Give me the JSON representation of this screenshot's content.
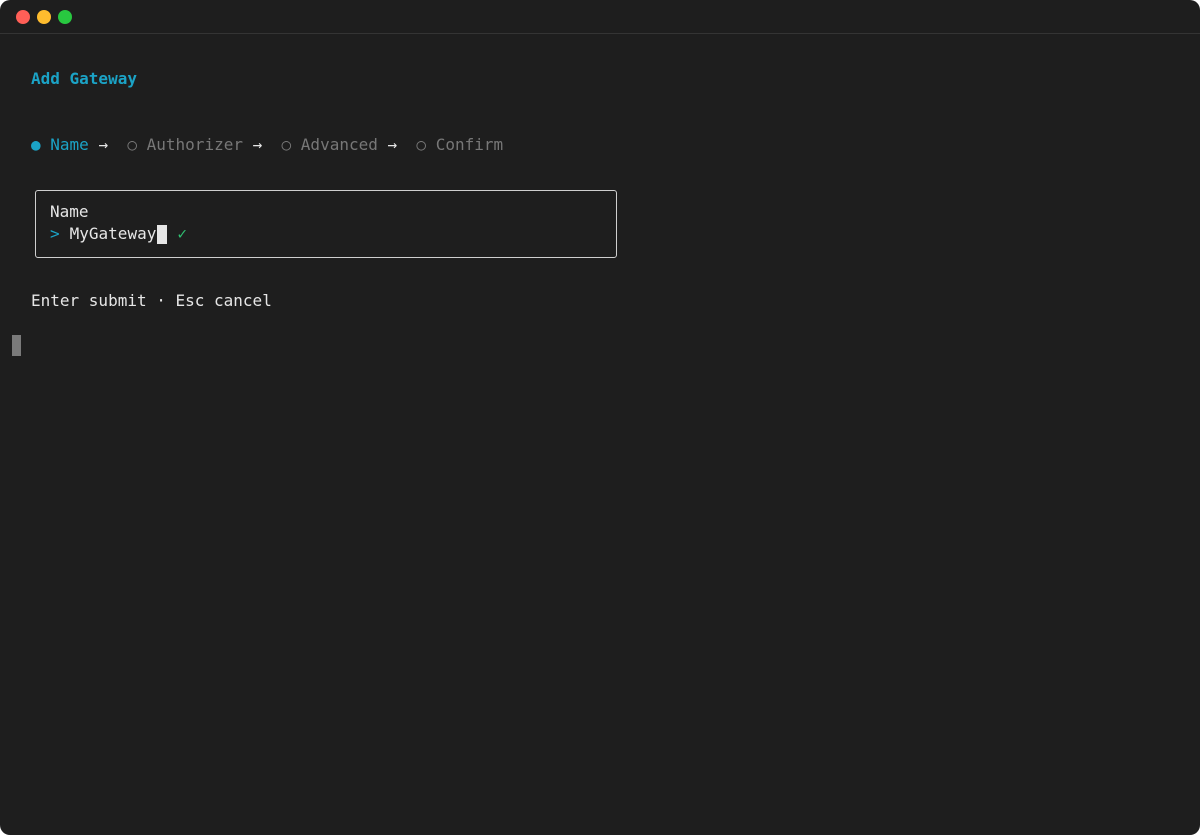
{
  "form": {
    "title": "Add Gateway",
    "steps": [
      {
        "label": "Name",
        "state": "active",
        "marker": "●"
      },
      {
        "label": "Authorizer",
        "state": "pending",
        "marker": "○"
      },
      {
        "label": "Advanced",
        "state": "pending",
        "marker": "○"
      },
      {
        "label": "Confirm",
        "state": "pending",
        "marker": "○"
      }
    ],
    "separator": "→",
    "field": {
      "label": "Name",
      "prompt": ">",
      "value": "MyGateway",
      "valid_mark": "✓"
    },
    "hint": "Enter submit · Esc cancel"
  },
  "colors": {
    "accent": "#1ba3c6",
    "valid": "#2fbf71",
    "muted": "#777777",
    "background": "#1e1e1e"
  }
}
